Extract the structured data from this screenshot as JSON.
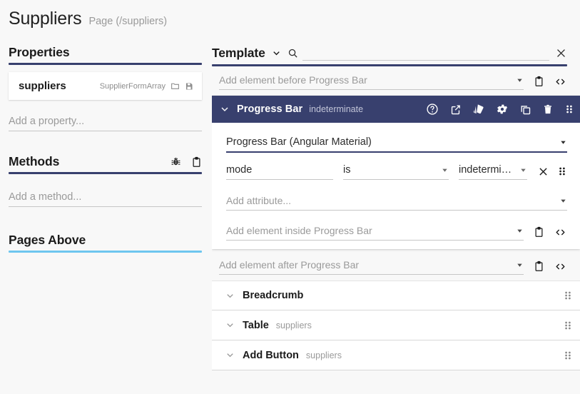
{
  "page": {
    "title": "Suppliers",
    "subtitle": "Page (/suppliers)"
  },
  "colors": {
    "navy": "#38406e",
    "sky": "#6ec6ef",
    "panel_bg": "#f8f8f8",
    "card_bg": "#ffffff",
    "muted_text": "#9a9a9a"
  },
  "sidebar": {
    "properties": {
      "heading": "Properties",
      "underline_color": "#38406e",
      "items": [
        {
          "name": "suppliers",
          "type": "SupplierFormArray",
          "icons": [
            "folder-icon",
            "save-icon"
          ]
        }
      ],
      "add_placeholder": "Add a property..."
    },
    "methods": {
      "heading": "Methods",
      "underline_color": "#38406e",
      "icons": [
        "bug-icon",
        "clipboard-icon"
      ],
      "add_placeholder": "Add a method..."
    },
    "pages_above": {
      "heading": "Pages Above",
      "underline_color": "#6ec6ef"
    }
  },
  "template": {
    "label": "Template",
    "underline_color": "#38406e",
    "search_value": "",
    "search_placeholder": "",
    "close_label": "×",
    "add_before": {
      "placeholder": "Add element before Progress Bar",
      "icons": [
        "clipboard-icon",
        "code-icon"
      ]
    },
    "selected_element": {
      "name": "Progress Bar",
      "subtitle": "indeterminate",
      "header_icons": [
        "help-icon",
        "open-in-new-icon",
        "style-icon",
        "gear-icon",
        "copy-icon",
        "delete-icon",
        "drag-handle-icon"
      ],
      "type_value": "Progress Bar (Angular Material)",
      "attributes": [
        {
          "name": "mode",
          "operator": "is",
          "value": "indeterminate"
        }
      ],
      "add_attribute_placeholder": "Add attribute...",
      "add_inside": {
        "placeholder": "Add element inside Progress Bar",
        "icons": [
          "clipboard-icon",
          "code-icon"
        ]
      }
    },
    "add_after": {
      "placeholder": "Add element after Progress Bar",
      "icons": [
        "clipboard-icon",
        "code-icon"
      ]
    },
    "collapsed_elements": [
      {
        "name": "Breadcrumb",
        "subtitle": ""
      },
      {
        "name": "Table",
        "subtitle": "suppliers"
      },
      {
        "name": "Add Button",
        "subtitle": "suppliers"
      }
    ]
  }
}
